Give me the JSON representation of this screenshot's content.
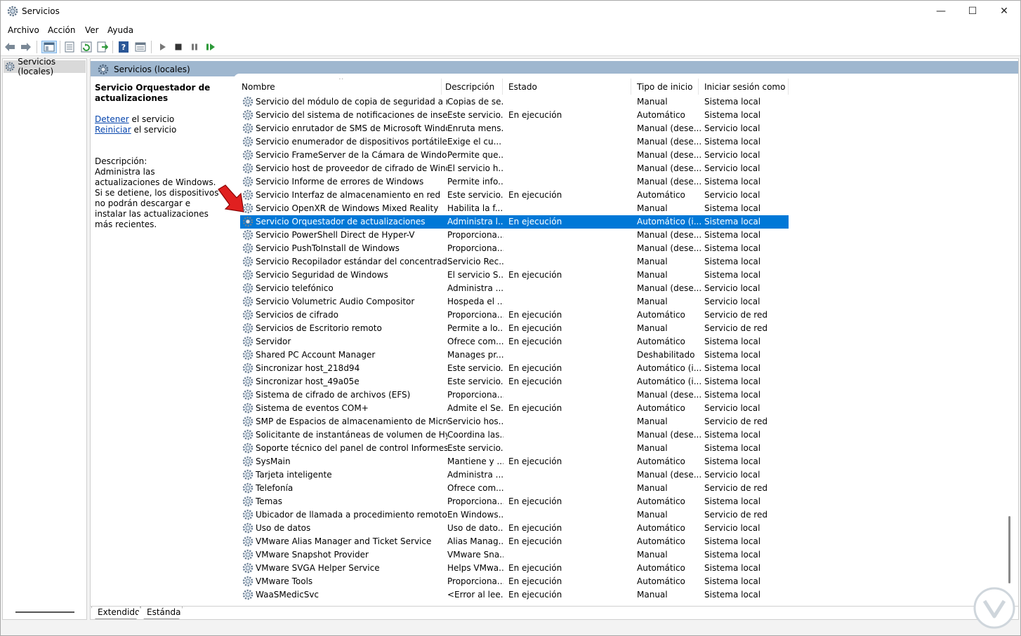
{
  "window": {
    "title": "Servicios",
    "minimize": "—",
    "maximize": "☐",
    "close": "✕"
  },
  "menu": [
    "Archivo",
    "Acción",
    "Ver",
    "Ayuda"
  ],
  "tree": {
    "root": "Servicios (locales)"
  },
  "panel": {
    "header": "Servicios (locales)",
    "selected_service": "Servicio Orquestador de actualizaciones",
    "stop_link": "Detener",
    "stop_suffix": " el servicio",
    "restart_link": "Reiniciar",
    "restart_suffix": " el servicio",
    "description_label": "Descripción:",
    "description_text": "Administra las actualizaciones de Windows. Si se detiene, los dispositivos no podrán descargar e instalar las actualizaciones más recientes."
  },
  "columns": [
    "Nombre",
    "Descripción",
    "Estado",
    "Tipo de inicio",
    "Iniciar sesión como"
  ],
  "rows": [
    [
      "Servicio del módulo de copia de seguridad a niv...",
      "Copias de se...",
      "",
      "Manual",
      "Sistema local"
    ],
    [
      "Servicio del sistema de notificaciones de inserció...",
      "Este servicio...",
      "En ejecución",
      "Automático",
      "Sistema local"
    ],
    [
      "Servicio enrutador de SMS de Microsoft Windows.",
      "Enruta mens...",
      "",
      "Manual (dese...",
      "Servicio local"
    ],
    [
      "Servicio enumerador de dispositivos portátiles",
      "Exige el cu...",
      "",
      "Manual (dese...",
      "Sistema local"
    ],
    [
      "Servicio FrameServer de la Cámara de Windows",
      "Permite que...",
      "",
      "Manual (dese...",
      "Servicio local"
    ],
    [
      "Servicio host de proveedor de cifrado de Windows",
      "El servicio h...",
      "",
      "Manual (dese...",
      "Servicio local"
    ],
    [
      "Servicio Informe de errores de Windows",
      "Permite info...",
      "",
      "Manual (dese...",
      "Sistema local"
    ],
    [
      "Servicio Interfaz de almacenamiento en red",
      "Este servicio...",
      "En ejecución",
      "Automático",
      "Servicio local"
    ],
    [
      "Servicio OpenXR de Windows Mixed Reality",
      "Habilita la f...",
      "",
      "Manual",
      "Sistema local"
    ],
    [
      "Servicio Orquestador de actualizaciones",
      "Administra l...",
      "En ejecución",
      "Automático (i...",
      "Sistema local"
    ],
    [
      "Servicio PowerShell Direct de Hyper-V",
      "Proporciona...",
      "",
      "Manual (dese...",
      "Sistema local"
    ],
    [
      "Servicio PushToInstall de Windows",
      "Proporciona...",
      "",
      "Manual (dese...",
      "Sistema local"
    ],
    [
      "Servicio Recopilador estándar del concentrador ...",
      "Servicio Rec...",
      "",
      "Manual",
      "Sistema local"
    ],
    [
      "Servicio Seguridad de Windows",
      "El servicio S...",
      "En ejecución",
      "Manual",
      "Sistema local"
    ],
    [
      "Servicio telefónico",
      "Administra ...",
      "",
      "Manual (dese...",
      "Servicio local"
    ],
    [
      "Servicio Volumetric Audio Compositor",
      "Hospeda el ...",
      "",
      "Manual",
      "Servicio local"
    ],
    [
      "Servicios de cifrado",
      "Proporciona...",
      "En ejecución",
      "Automático",
      "Servicio de red"
    ],
    [
      "Servicios de Escritorio remoto",
      "Permite a lo...",
      "En ejecución",
      "Manual",
      "Servicio de red"
    ],
    [
      "Servidor",
      "Ofrece com...",
      "En ejecución",
      "Automático",
      "Sistema local"
    ],
    [
      "Shared PC Account Manager",
      "Manages pr...",
      "",
      "Deshabilitado",
      "Sistema local"
    ],
    [
      "Sincronizar host_218d94",
      "Este servicio...",
      "En ejecución",
      "Automático (i...",
      "Sistema local"
    ],
    [
      "Sincronizar host_49a05e",
      "Este servicio...",
      "En ejecución",
      "Automático (i...",
      "Sistema local"
    ],
    [
      "Sistema de cifrado de archivos (EFS)",
      "Proporciona...",
      "",
      "Manual (dese...",
      "Sistema local"
    ],
    [
      "Sistema de eventos COM+",
      "Admite el Se...",
      "En ejecución",
      "Automático",
      "Servicio local"
    ],
    [
      "SMP de Espacios de almacenamiento de Micros...",
      "Servicio hos...",
      "",
      "Manual",
      "Servicio de red"
    ],
    [
      "Solicitante de instantáneas de volumen de Hype...",
      "Coordina las...",
      "",
      "Manual (dese...",
      "Sistema local"
    ],
    [
      "Soporte técnico del panel de control Informes d...",
      "Este servicio...",
      "",
      "Manual",
      "Sistema local"
    ],
    [
      "SysMain",
      "Mantiene y ...",
      "En ejecución",
      "Automático",
      "Sistema local"
    ],
    [
      "Tarjeta inteligente",
      "Administra ...",
      "",
      "Manual (dese...",
      "Servicio local"
    ],
    [
      "Telefonía",
      "Ofrece com...",
      "",
      "Manual",
      "Servicio de red"
    ],
    [
      "Temas",
      "Proporciona...",
      "En ejecución",
      "Automático",
      "Sistema local"
    ],
    [
      "Ubicador de llamada a procedimiento remoto (R...",
      "En Windows...",
      "",
      "Manual",
      "Servicio de red"
    ],
    [
      "Uso de datos",
      "Uso de dato...",
      "En ejecución",
      "Automático",
      "Servicio local"
    ],
    [
      "VMware Alias Manager and Ticket Service",
      "Alias Manag...",
      "En ejecución",
      "Automático",
      "Sistema local"
    ],
    [
      "VMware Snapshot Provider",
      "VMware Sna...",
      "",
      "Manual",
      "Sistema local"
    ],
    [
      "VMware SVGA Helper Service",
      "Helps VMwa...",
      "En ejecución",
      "Automático",
      "Sistema local"
    ],
    [
      "VMware Tools",
      "Proporciona...",
      "En ejecución",
      "Automático",
      "Sistema local"
    ],
    [
      "WaaSMedicSvc",
      "<Error al lee...",
      "En ejecución",
      "Manual",
      "Sistema local"
    ]
  ],
  "selected_index": 9,
  "tabs": [
    "Extendido",
    "Estándar"
  ],
  "colors": {
    "selection": "#0078d7",
    "header_band": "#9fb7cf",
    "link": "#0645ad",
    "arrow": "#e02020"
  }
}
